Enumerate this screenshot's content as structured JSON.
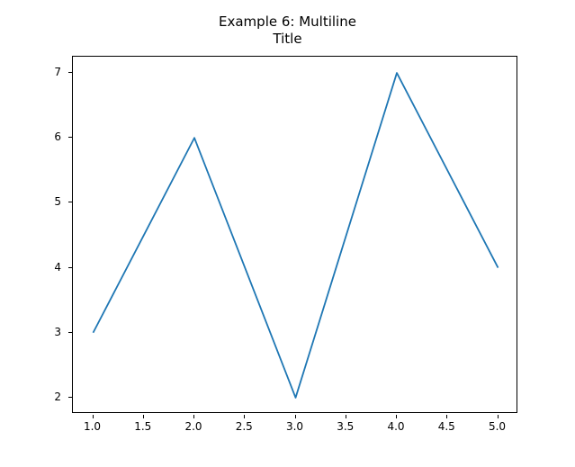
{
  "chart_data": {
    "type": "line",
    "title_line1": "Example 6: Multiline",
    "title_line2": "Title",
    "xlabel": "",
    "ylabel": "",
    "x": [
      1,
      2,
      3,
      4,
      5
    ],
    "values": [
      3,
      6,
      2,
      7,
      4
    ],
    "xlim": [
      0.8,
      5.2
    ],
    "ylim": [
      1.75,
      7.25
    ],
    "x_ticks": [
      "1.0",
      "1.5",
      "2.0",
      "2.5",
      "3.0",
      "3.5",
      "4.0",
      "4.5",
      "5.0"
    ],
    "x_tick_vals": [
      1.0,
      1.5,
      2.0,
      2.5,
      3.0,
      3.5,
      4.0,
      4.5,
      5.0
    ],
    "y_ticks": [
      "2",
      "3",
      "4",
      "5",
      "6",
      "7"
    ],
    "y_tick_vals": [
      2,
      3,
      4,
      5,
      6,
      7
    ],
    "line_color": "#1f77b4"
  }
}
